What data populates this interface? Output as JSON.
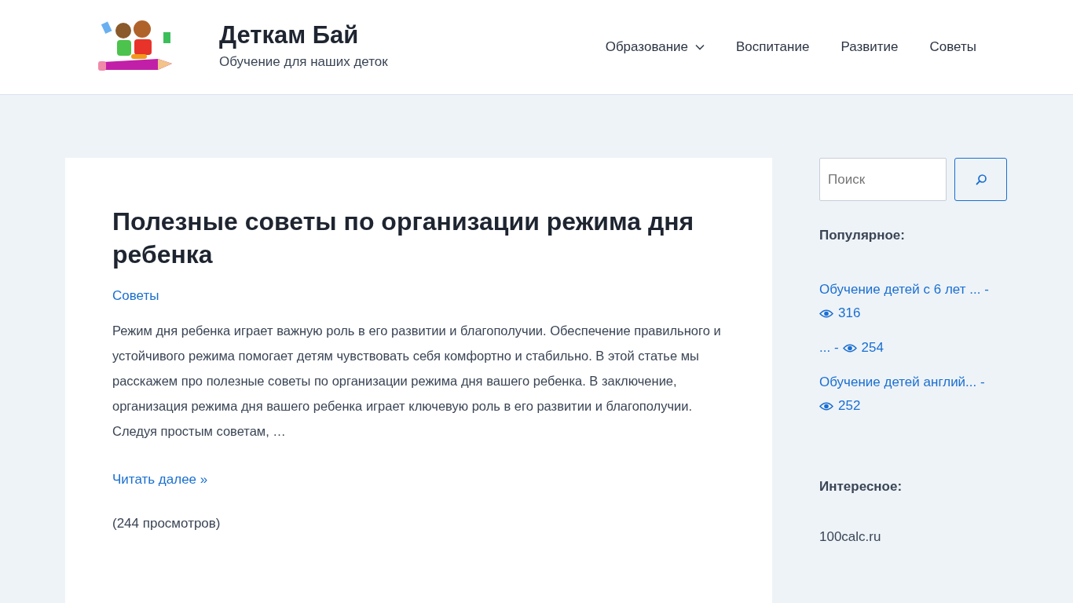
{
  "header": {
    "site_title": "Деткам Бай",
    "tagline": "Обучение для наших деток",
    "nav": [
      {
        "label": "Образование",
        "has_dropdown": true
      },
      {
        "label": "Воспитание",
        "has_dropdown": false
      },
      {
        "label": "Развитие",
        "has_dropdown": false
      },
      {
        "label": "Советы",
        "has_dropdown": false
      }
    ]
  },
  "article": {
    "title": "Полезные советы по организации режима дня ребенка",
    "category": "Советы",
    "excerpt": "Режим дня ребенка играет важную роль в его развитии и благополучии. Обеспечение правильного и устойчивого режима помогает детям чувствовать себя комфортно и стабильно. В этой статье мы расскажем про полезные советы по организации режима дня вашего ребенка. В заключение, организация режима дня вашего ребенка играет ключевую роль в его развитии и благополучии. Следуя простым советам, …",
    "read_more": "Читать далее »",
    "views": "(244 просмотров)"
  },
  "sidebar": {
    "search": {
      "placeholder": "Поиск"
    },
    "popular_heading": "Популярное:",
    "popular": [
      {
        "title": "Обучение детей с 6 лет ... -",
        "views": "316"
      },
      {
        "title": "... -",
        "views": "254"
      },
      {
        "title": "Обучение детей англий... -",
        "views": "252"
      }
    ],
    "interesting_heading": "Интересное:",
    "interesting_text": "100calc.ru"
  }
}
